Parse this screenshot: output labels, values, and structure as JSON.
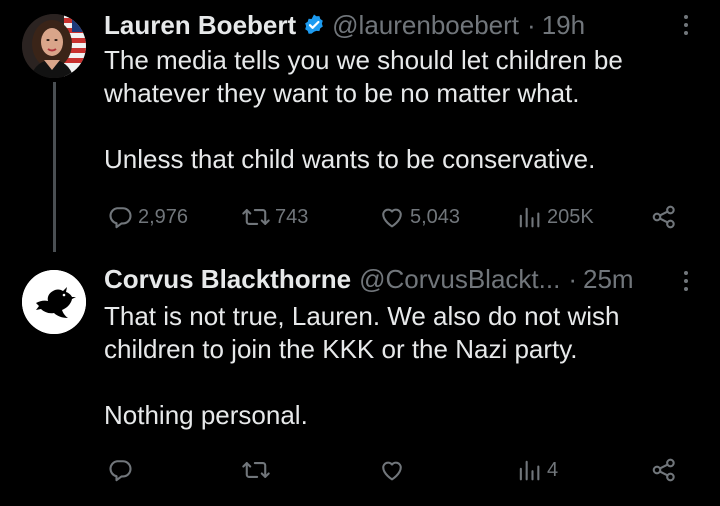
{
  "tweets": [
    {
      "author": {
        "display_name": "Lauren Boebert",
        "handle": "@laurenboebert",
        "verified": true,
        "avatar_icon": "profile-photo"
      },
      "separator": "·",
      "time": "19h",
      "text": [
        "The media tells you we should let children be whatever they want to be no matter what.",
        "Unless that child wants to be conservative."
      ],
      "stats": {
        "replies": "2,976",
        "retweets": "743",
        "likes": "5,043",
        "views": "205K"
      }
    },
    {
      "author": {
        "display_name": "Corvus Blackthorne",
        "handle": "@CorvusBlackt...",
        "verified": false,
        "avatar_icon": "crow-icon"
      },
      "separator": "·",
      "time": "25m",
      "text": [
        "That is not true, Lauren. We also do not wish children to join the KKK or the Nazi party.",
        "Nothing personal."
      ],
      "stats": {
        "replies": "",
        "retweets": "",
        "likes": "",
        "views": "4"
      }
    }
  ],
  "colors": {
    "background": "#000000",
    "primary_text": "#e7e9ea",
    "secondary_text": "#71767b",
    "verified_badge": "#1d9bf0",
    "thread_line": "#4a4f53"
  }
}
